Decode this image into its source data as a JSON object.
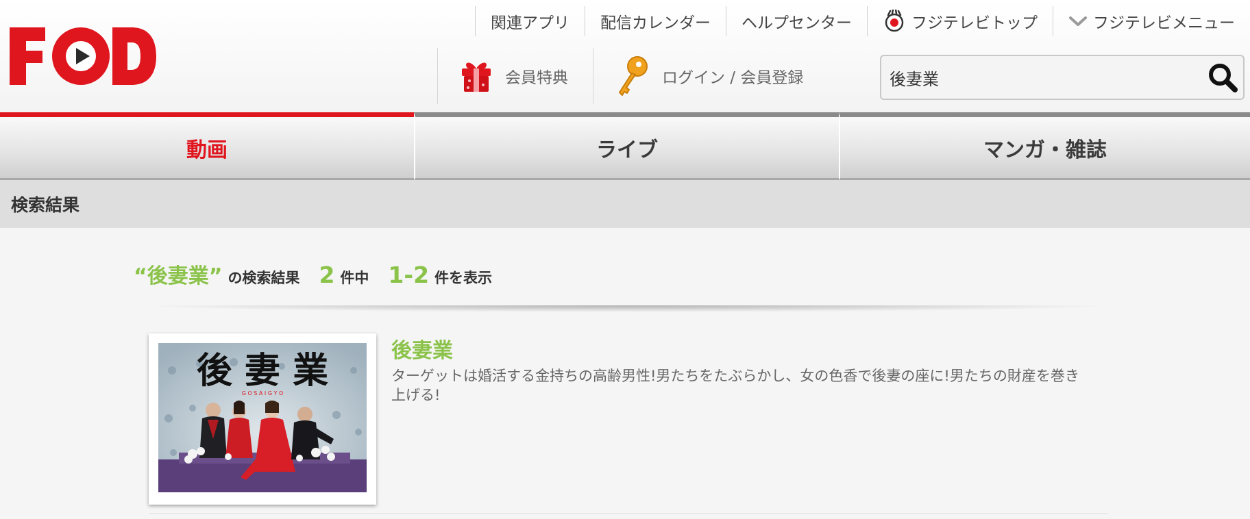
{
  "brand": {
    "logo_text": "FOD",
    "accent": "#e0161f",
    "green": "#8bc34a"
  },
  "util_nav": [
    {
      "label": "関連アプリ",
      "icon": ""
    },
    {
      "label": "配信カレンダー",
      "icon": ""
    },
    {
      "label": "ヘルプセンター",
      "icon": ""
    },
    {
      "label": "フジテレビトップ",
      "icon": "fujitv-eye-icon"
    },
    {
      "label": "フジテレビメニュー",
      "icon": "chevron-down-icon"
    }
  ],
  "member_nav": {
    "benefit_label": "会員特典",
    "benefit_icon": "gift-icon",
    "login_label": "ログイン / 会員登録",
    "login_icon": "key-icon"
  },
  "search": {
    "value": "後妻業",
    "icon": "search-icon"
  },
  "tabs": [
    {
      "label": "動画",
      "active": true
    },
    {
      "label": "ライブ",
      "active": false
    },
    {
      "label": "マンガ・雑誌",
      "active": false
    }
  ],
  "section_title": "検索結果",
  "summary": {
    "query_quoted": "“後妻業”",
    "label_results": "の検索結果",
    "total": "2",
    "label_of": "件中",
    "range": "1-2",
    "label_showing": "件を表示"
  },
  "results": [
    {
      "title": "後妻業",
      "thumb_title": "後 妻 業",
      "thumb_subtitle": "G O S A I G Y O",
      "description": "ターゲットは婚活する金持ちの高齢男性!男たちをたぶらかし、女の色香で後妻の座に!男たちの財産を巻き上げる!"
    }
  ]
}
